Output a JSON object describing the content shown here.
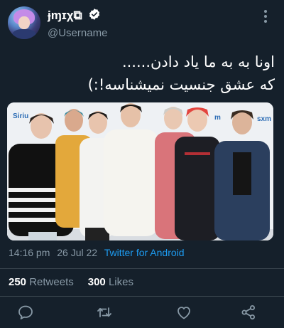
{
  "author": {
    "display_name": "ɉɱɪχ",
    "display_name_suffix": "⧉",
    "username": "@Username"
  },
  "tweet": {
    "lines": [
      "اونا به به ما یاد دادن......",
      "که عشق جنسیت نمیشناسه!:)"
    ]
  },
  "photo_backdrop_texts": [
    "Siriu",
    "sxm",
    "m",
    "xm",
    "m"
  ],
  "meta": {
    "time": "14:16 pm",
    "date": "26 Jul 22",
    "app": "Twitter for Android"
  },
  "stats": {
    "retweets_count": "250",
    "retweets_label": "Retweets",
    "likes_count": "300",
    "likes_label": "Likes"
  },
  "icons": {
    "more": "more-vertical-icon",
    "verified": "verified-badge-icon",
    "reply": "reply-icon",
    "retweet": "retweet-icon",
    "like": "heart-icon",
    "share": "share-icon"
  },
  "colors": {
    "background": "#15202b",
    "secondary_text": "#8899a6",
    "link": "#1d9bf0",
    "divider": "#38444d"
  }
}
